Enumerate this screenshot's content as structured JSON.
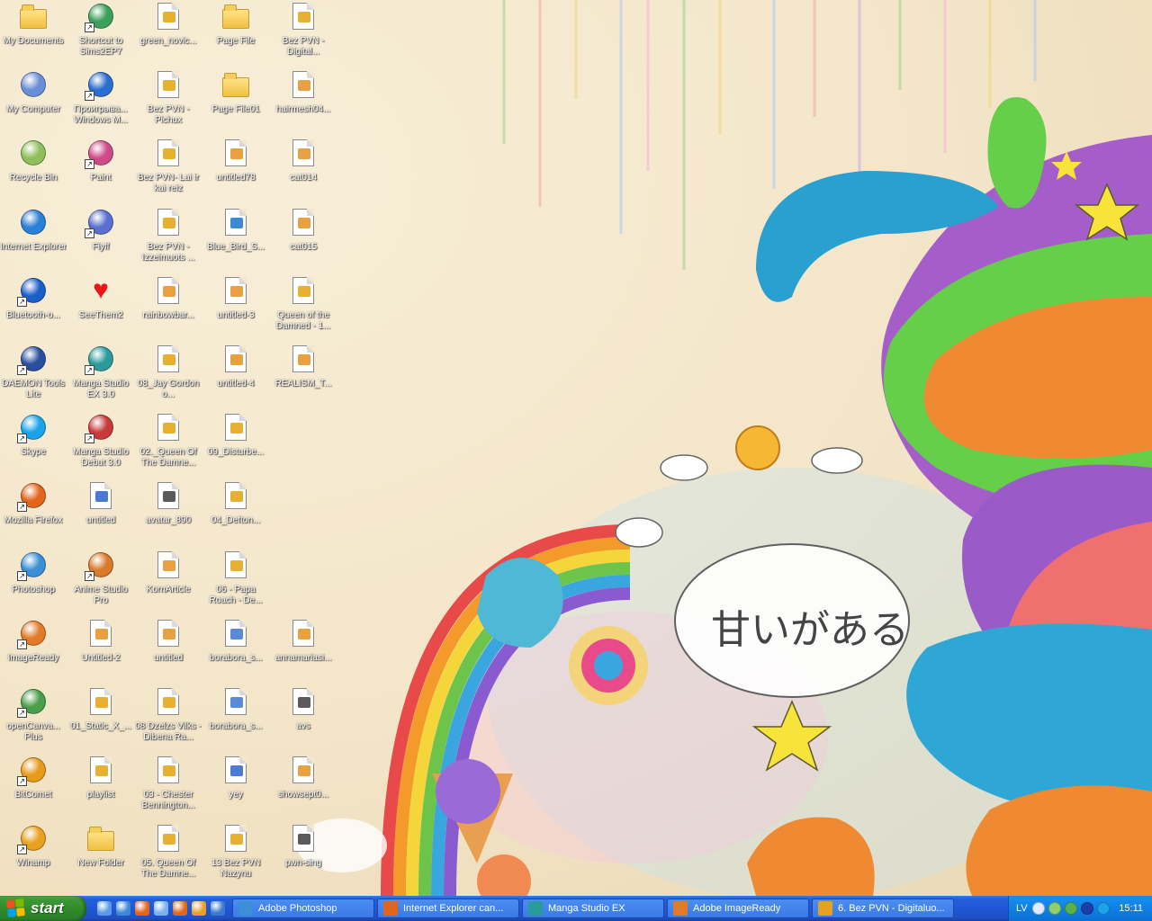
{
  "desktop": {
    "columns": [
      [
        {
          "label": "My Documents",
          "icon": "my-documents-icon",
          "shortcut": false,
          "color": "#f0c040"
        },
        {
          "label": "My Computer",
          "icon": "my-computer-icon",
          "shortcut": false,
          "color": "#6b8fd6"
        },
        {
          "label": "Recycle Bin",
          "icon": "recycle-bin-icon",
          "shortcut": false,
          "color": "#8fbf5a"
        },
        {
          "label": "Internet Explorer",
          "icon": "internet-explorer-icon",
          "shortcut": false,
          "color": "#2a7fd6"
        },
        {
          "label": "Bluetooth-o...",
          "icon": "bluetooth-icon",
          "shortcut": true,
          "color": "#1a5fc8"
        },
        {
          "label": "DAEMON Tools Lite",
          "icon": "daemon-tools-icon",
          "shortcut": true,
          "color": "#2a4fa0"
        },
        {
          "label": "Skype",
          "icon": "skype-icon",
          "shortcut": true,
          "color": "#1aa3e8"
        },
        {
          "label": "Mozilla Firefox",
          "icon": "firefox-icon",
          "shortcut": true,
          "color": "#e2651c"
        },
        {
          "label": "Photoshop",
          "icon": "photoshop-icon",
          "shortcut": true,
          "color": "#3a8fd6"
        },
        {
          "label": "ImageReady",
          "icon": "imageready-icon",
          "shortcut": true,
          "color": "#e27a2a"
        },
        {
          "label": "openCanva... Plus",
          "icon": "opencanvas-icon",
          "shortcut": true,
          "color": "#4aa04a"
        },
        {
          "label": "BitComet",
          "icon": "bitcomet-icon",
          "shortcut": true,
          "color": "#e89a1a"
        },
        {
          "label": "Winamp",
          "icon": "winamp-icon",
          "shortcut": true,
          "color": "#e8a020"
        }
      ],
      [
        {
          "label": "Shortcut to Sims2EP7",
          "icon": "sims-icon",
          "shortcut": true,
          "color": "#3aa05a"
        },
        {
          "label": "Проигрыва... Windows M...",
          "icon": "media-player-icon",
          "shortcut": true,
          "color": "#2a6fd0"
        },
        {
          "label": "Paint",
          "icon": "paint-icon",
          "shortcut": true,
          "color": "#d04a8a"
        },
        {
          "label": "Flyff",
          "icon": "flyff-icon",
          "shortcut": true,
          "color": "#5a6fd0"
        },
        {
          "label": "SeeThem2",
          "icon": "heart-icon",
          "shortcut": false,
          "color": "#e81818"
        },
        {
          "label": "Manga Studio EX 3.0",
          "icon": "manga-studio-icon",
          "shortcut": true,
          "color": "#2a9a9a"
        },
        {
          "label": "Manga Studio Debut 3.0",
          "icon": "manga-studio-debut-icon",
          "shortcut": true,
          "color": "#c83a3a"
        },
        {
          "label": "untitled",
          "icon": "brush-file-icon",
          "shortcut": false,
          "color": "#4a7ad6"
        },
        {
          "label": "Anime Studio Pro",
          "icon": "anime-studio-icon",
          "shortcut": true,
          "color": "#d87a2a"
        },
        {
          "label": "Untitled-2",
          "icon": "image-file-icon",
          "shortcut": false,
          "color": "#e8a040"
        },
        {
          "label": "01_Static_X_...",
          "icon": "audio-file-icon",
          "shortcut": false,
          "color": "#e8b030"
        },
        {
          "label": "playlist",
          "icon": "playlist-file-icon",
          "shortcut": false,
          "color": "#e8b030"
        },
        {
          "label": "New Folder",
          "icon": "folder-icon",
          "shortcut": false,
          "color": "#f0c040"
        }
      ],
      [
        {
          "label": "green_novic...",
          "icon": "audio-file-icon",
          "shortcut": false,
          "color": "#e8b030"
        },
        {
          "label": "Bez PVN - Pichux",
          "icon": "audio-file-icon",
          "shortcut": false,
          "color": "#e8b030"
        },
        {
          "label": "Bez PVN- Lai ir kai reiz",
          "icon": "audio-file-icon",
          "shortcut": false,
          "color": "#e8b030"
        },
        {
          "label": "Bez PVN - Izzeimuots ...",
          "icon": "audio-file-icon",
          "shortcut": false,
          "color": "#e8b030"
        },
        {
          "label": "rainbowbar...",
          "icon": "image-file-icon",
          "shortcut": false,
          "color": "#e8a040"
        },
        {
          "label": "08_Jay Gordon o...",
          "icon": "audio-file-icon",
          "shortcut": false,
          "color": "#e8b030"
        },
        {
          "label": "02._Queen Of The Damne...",
          "icon": "audio-file-icon",
          "shortcut": false,
          "color": "#e8b030"
        },
        {
          "label": "avatar_890",
          "icon": "web-file-icon",
          "shortcut": false,
          "color": "#5a5a5a"
        },
        {
          "label": "KornArticle",
          "icon": "image-file-icon",
          "shortcut": false,
          "color": "#e8a040"
        },
        {
          "label": "untitled",
          "icon": "image-file-icon",
          "shortcut": false,
          "color": "#e8a040"
        },
        {
          "label": "08 Dzelzs Vilks - Dibena Ra...",
          "icon": "audio-file-icon",
          "shortcut": false,
          "color": "#e8b030"
        },
        {
          "label": "03 - Chester Bennington...",
          "icon": "audio-file-icon",
          "shortcut": false,
          "color": "#e8b030"
        },
        {
          "label": "05. Queen Of The Damne...",
          "icon": "audio-file-icon",
          "shortcut": false,
          "color": "#e8b030"
        }
      ],
      [
        {
          "label": "Page File",
          "icon": "folder-icon",
          "shortcut": false,
          "color": "#f0c040"
        },
        {
          "label": "Page File01",
          "icon": "folder-icon",
          "shortcut": false,
          "color": "#f0c040"
        },
        {
          "label": "untitled78",
          "icon": "image-file-icon",
          "shortcut": false,
          "color": "#e8a040"
        },
        {
          "label": "Blue_Bird_S...",
          "icon": "image-file-icon",
          "shortcut": false,
          "color": "#3a8ad6"
        },
        {
          "label": "untitled-3",
          "icon": "image-file-icon",
          "shortcut": false,
          "color": "#e8a040"
        },
        {
          "label": "untitled-4",
          "icon": "image-file-icon",
          "shortcut": false,
          "color": "#e8a040"
        },
        {
          "label": "09_Disturbe...",
          "icon": "audio-file-icon",
          "shortcut": false,
          "color": "#e8b030"
        },
        {
          "label": "04_Defton...",
          "icon": "audio-file-icon",
          "shortcut": false,
          "color": "#e8b030"
        },
        {
          "label": "06 - Papa Roach - De...",
          "icon": "audio-file-icon",
          "shortcut": false,
          "color": "#e8b030"
        },
        {
          "label": "borabora_s...",
          "icon": "image-file-icon",
          "shortcut": false,
          "color": "#5a8ad6"
        },
        {
          "label": "borabora_s...",
          "icon": "image-file-icon",
          "shortcut": false,
          "color": "#5a8ad6"
        },
        {
          "label": "yey",
          "icon": "brush-file-icon",
          "shortcut": false,
          "color": "#4a7ad6"
        },
        {
          "label": "13 Bez PVN Nazynu",
          "icon": "audio-file-icon",
          "shortcut": false,
          "color": "#e8b030"
        }
      ],
      [
        {
          "label": "Bez PVN - Digital...",
          "icon": "audio-file-icon",
          "shortcut": false,
          "color": "#e8b030"
        },
        {
          "label": "hairmesh04...",
          "icon": "image-file-icon",
          "shortcut": false,
          "color": "#e8a040"
        },
        {
          "label": "cat014",
          "icon": "image-file-icon",
          "shortcut": false,
          "color": "#e8a040"
        },
        {
          "label": "cat015",
          "icon": "image-file-icon",
          "shortcut": false,
          "color": "#e8a040"
        },
        {
          "label": "Queen of the Damned - 1...",
          "icon": "audio-file-icon",
          "shortcut": false,
          "color": "#e8b030"
        },
        {
          "label": "REALISM_T...",
          "icon": "image-file-icon",
          "shortcut": false,
          "color": "#e8a040"
        },
        {
          "label": "",
          "icon": "",
          "shortcut": false,
          "color": ""
        },
        {
          "label": "",
          "icon": "",
          "shortcut": false,
          "color": ""
        },
        {
          "label": "",
          "icon": "",
          "shortcut": false,
          "color": ""
        },
        {
          "label": "annamariasi...",
          "icon": "image-file-icon",
          "shortcut": false,
          "color": "#e8a040"
        },
        {
          "label": "avs",
          "icon": "web-file-icon",
          "shortcut": false,
          "color": "#5a5a5a"
        },
        {
          "label": "showsept0...",
          "icon": "image-file-icon",
          "shortcut": false,
          "color": "#e8a040"
        },
        {
          "label": "pwn-sing",
          "icon": "web-file-icon",
          "shortcut": false,
          "color": "#5a5a5a"
        }
      ]
    ]
  },
  "wallpaper": {
    "text": "甘いがある"
  },
  "taskbar": {
    "start_label": "start",
    "quick_launch": [
      {
        "icon": "show-desktop-icon",
        "color": "#5a9ae8"
      },
      {
        "icon": "internet-explorer-icon",
        "color": "#3a8ad6"
      },
      {
        "icon": "firefox-icon",
        "color": "#e2651c"
      },
      {
        "icon": "search-icon",
        "color": "#7ab0f0"
      },
      {
        "icon": "firefox-icon",
        "color": "#e2651c"
      },
      {
        "icon": "winamp-icon",
        "color": "#e8a020"
      },
      {
        "icon": "media-player-icon",
        "color": "#3a7ad0"
      }
    ],
    "tasks": [
      {
        "label": "Adobe Photoshop",
        "icon": "photoshop-icon",
        "color": "#3a8fd6"
      },
      {
        "label": "Internet Explorer can...",
        "icon": "firefox-icon",
        "color": "#e2651c"
      },
      {
        "label": "Manga Studio EX",
        "icon": "manga-studio-icon",
        "color": "#2a9a9a"
      },
      {
        "label": "Adobe ImageReady",
        "icon": "imageready-icon",
        "color": "#e27a2a"
      },
      {
        "label": "6. Bez PVN - Digitaluo...",
        "icon": "winamp-icon",
        "color": "#e8a020"
      }
    ],
    "tray": {
      "language": "LV",
      "icons": [
        {
          "icon": "tray-arrow-icon",
          "color": "#e0ecff"
        },
        {
          "icon": "network-icon",
          "color": "#8fd06a"
        },
        {
          "icon": "security-icon",
          "color": "#5ab04a"
        },
        {
          "icon": "bluetooth-icon",
          "color": "#1a3fa8"
        },
        {
          "icon": "skype-icon",
          "color": "#1aa3e8"
        }
      ],
      "clock": "15:11"
    }
  }
}
